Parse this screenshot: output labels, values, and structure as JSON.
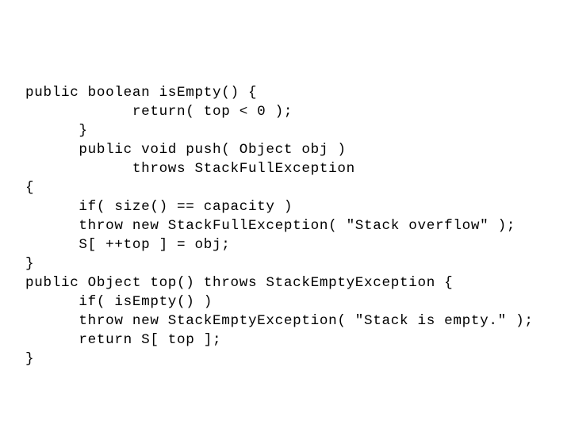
{
  "slide": {
    "background_color": "#ffffff",
    "text_color": "#000000",
    "kind": "code-listing",
    "language": "Java"
  },
  "code": {
    "lines": [
      "public boolean isEmpty() {",
      "            return( top < 0 );",
      "      }",
      "      public void push( Object obj )",
      "            throws StackFullException",
      "{",
      "      if( size() == capacity )",
      "      throw new StackFullException( \"Stack overflow\" );",
      "      S[ ++top ] = obj;",
      "}",
      "public Object top() throws StackEmptyException {",
      "      if( isEmpty() )",
      "      throw new StackEmptyException( \"Stack is empty.\" );",
      "      return S[ top ];",
      "}"
    ]
  }
}
